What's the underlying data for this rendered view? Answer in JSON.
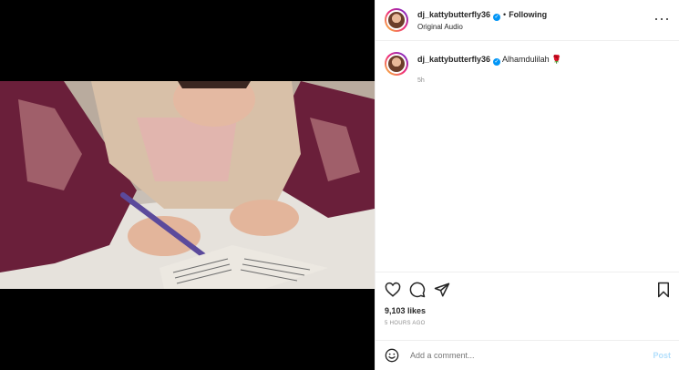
{
  "header": {
    "username": "dj_kattybutterfly36",
    "verified_mark": "✓",
    "separator": "•",
    "follow_status": "Following",
    "audio": "Original Audio"
  },
  "caption": {
    "username": "dj_kattybutterfly36",
    "text": "Alhamdulilah",
    "emoji": "🌹",
    "time": "5h"
  },
  "stats": {
    "likes": "9,103 likes",
    "posted_ago": "5 HOURS AGO"
  },
  "comment": {
    "placeholder": "Add a comment...",
    "post_label": "Post"
  },
  "icons": [
    "heart-icon",
    "comment-icon",
    "share-icon",
    "bookmark-icon",
    "emoji-icon",
    "more-icon",
    "speaker-icon"
  ],
  "colors": {
    "accent": "#0095f6",
    "post_disabled": "#b2dffc",
    "muted_text": "#8e8e8e"
  }
}
